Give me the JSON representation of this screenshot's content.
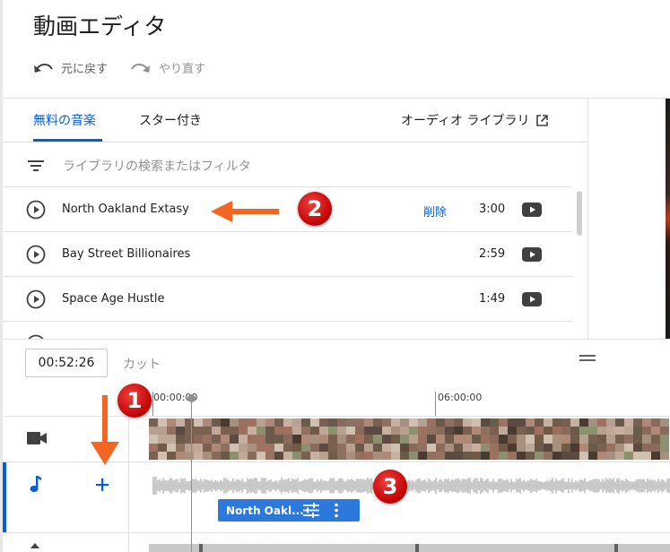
{
  "header": {
    "title": "動画エディタ",
    "undo_label": "元に戻す",
    "redo_label": "やり直す"
  },
  "tabs": [
    {
      "label": "無料の音楽",
      "active": true
    },
    {
      "label": "スター付き",
      "active": false
    }
  ],
  "audio_library_link": "オーディオ ライブラリ",
  "filter": {
    "placeholder": "ライブラリの検索またはフィルタ"
  },
  "tracks": [
    {
      "name": "North Oakland Extasy",
      "action": "削除",
      "duration": "3:00"
    },
    {
      "name": "Bay Street Billionaires",
      "action": "",
      "duration": "2:59"
    },
    {
      "name": "Space Age Hustle",
      "action": "",
      "duration": "1:49"
    }
  ],
  "timeline": {
    "timecode": "00:52:26",
    "cut_label": "カット",
    "ruler_labels": [
      "00:00:00",
      "06:00:00"
    ],
    "clip_label": "North Oakl..."
  },
  "annotations": [
    "1",
    "2",
    "3"
  ],
  "colors": {
    "accent": "#065fd4",
    "annotation_red": "#c00000",
    "annotation_arrow": "#f26522"
  },
  "icons": {
    "undo": "undo-icon",
    "redo": "redo-icon",
    "external": "open-in-new-icon",
    "filter": "filter-icon",
    "play": "play-circle-icon",
    "youtube": "youtube-icon",
    "video_track": "videocam-icon",
    "audio_track": "music-note-icon",
    "add": "plus-icon",
    "tune": "tune-icon",
    "more": "more-vert-icon"
  }
}
